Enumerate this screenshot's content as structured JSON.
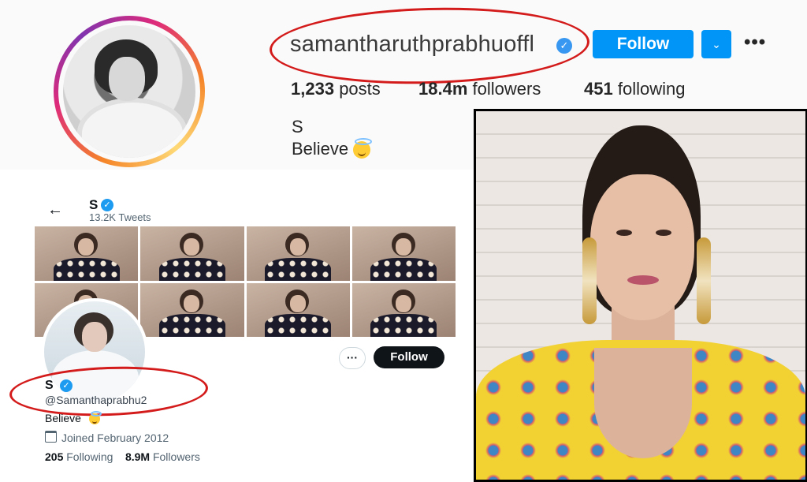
{
  "instagram": {
    "username": "samantharuthprabhuoffl",
    "follow_label": "Follow",
    "dropdown_icon": "chevron-down-icon",
    "more_icon": "more-dots-icon",
    "posts_count": "1,233",
    "posts_label": "posts",
    "followers_count": "18.4m",
    "followers_label": "followers",
    "following_count": "451",
    "following_label": "following",
    "name": "S",
    "bio": "Believe",
    "bio_emoji": "halo-smile-emoji"
  },
  "twitter": {
    "header_name": "S",
    "tweets_count": "13.2K Tweets",
    "more_label": "···",
    "follow_label": "Follow",
    "name": "S",
    "handle": "@Samanthaprabhu2",
    "bio": "Believe",
    "joined": "Joined February 2012",
    "following_count": "205",
    "following_label": "Following",
    "followers_count": "8.9M",
    "followers_label": "Followers"
  },
  "colors": {
    "ig_blue": "#0095f6",
    "verified_blue": "#1d9bf0",
    "annotation_red": "#d41b1b"
  }
}
